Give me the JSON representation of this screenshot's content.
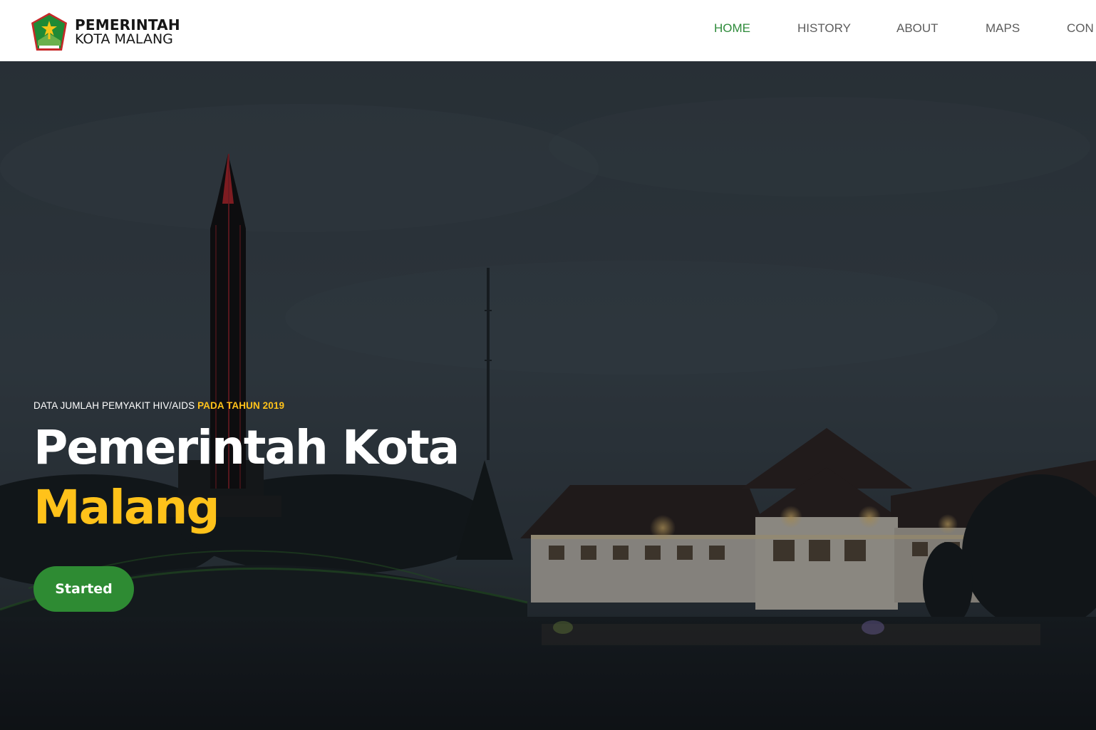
{
  "brand": {
    "line1": "PEMERINTAH",
    "line2": "KOTA MALANG",
    "logo_icon": "kota-malang-emblem-icon"
  },
  "nav": {
    "items": [
      {
        "label": "HOME",
        "active": true
      },
      {
        "label": "HISTORY",
        "active": false
      },
      {
        "label": "ABOUT",
        "active": false
      },
      {
        "label": "MAPS",
        "active": false
      },
      {
        "label": "CON",
        "active": false
      }
    ]
  },
  "hero": {
    "kicker_prefix": "DATA JUMLAH PEMYAKIT HIV/AIDS",
    "kicker_highlight": "PADA TAHUN 2019",
    "title_line1": "Pemerintah Kota",
    "title_line2": "Malang",
    "cta_label": "Started"
  },
  "colors": {
    "accent_green": "#2e8b33",
    "accent_yellow": "#ffc21a",
    "nav_active": "#2e8b3a",
    "nav_text": "#5c5c5c"
  }
}
